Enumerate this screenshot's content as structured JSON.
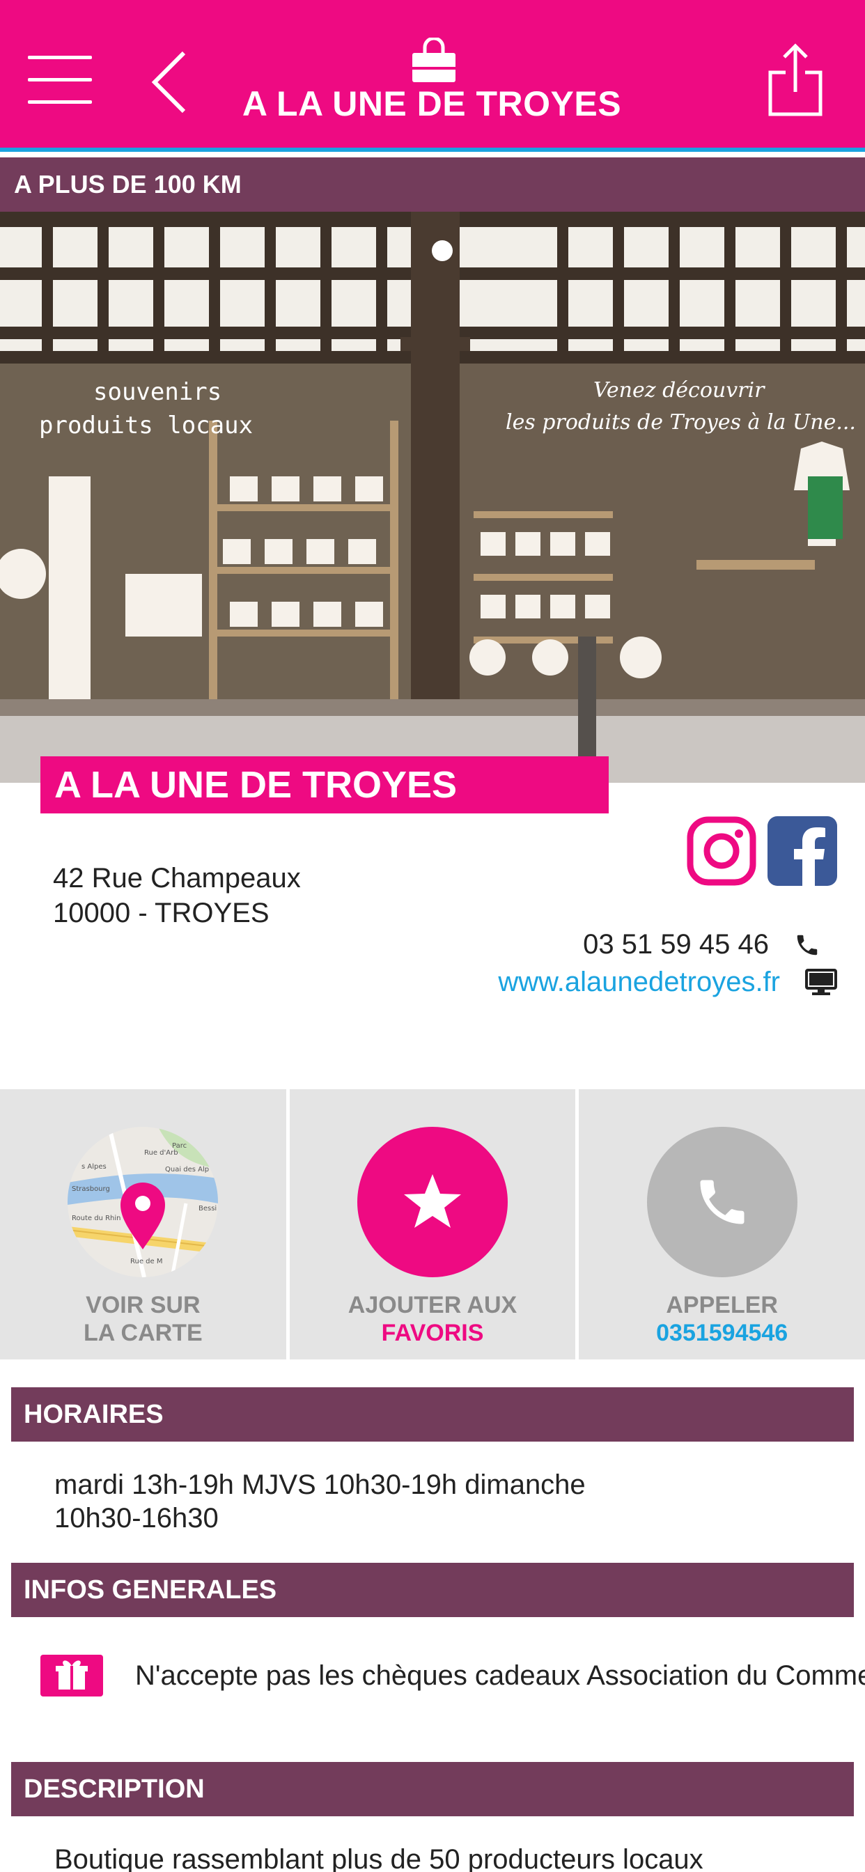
{
  "header": {
    "title": "A LA UNE DE TROYES",
    "menu_icon": "hamburger-menu-icon",
    "back_icon": "chevron-left-icon",
    "bag_icon": "shopping-bag-icon",
    "share_icon": "share-icon"
  },
  "distance": "A PLUS DE 100 KM",
  "photo": {
    "left_window_text_line1": "souvenirs",
    "left_window_text_line2": "produits locaux",
    "right_window_text_line1": "Venez découvrir",
    "right_window_text_line2": "les produits de Troyes à la Une..."
  },
  "shop": {
    "name": "A LA UNE DE TROYES",
    "address_line1": "42 Rue Champeaux",
    "address_line2": "10000 - TROYES",
    "phone": "03 51 59 45 46",
    "website": "www.alaunedetroyes.fr"
  },
  "actions": {
    "map_line1": "VOIR SUR",
    "map_line2": "LA CARTE",
    "fav_line1": "AJOUTER AUX",
    "fav_line2": "FAVORIS",
    "call_line1": "APPELER",
    "call_line2": "0351594546"
  },
  "map_thumbnail": {
    "labels": [
      "Parc",
      "Quai des Alp",
      "s Alpes",
      "Strasbourg",
      "Route du Rhin",
      "Rue de M",
      "Rue d'Arb",
      "Bessi"
    ]
  },
  "sections": {
    "hours_title": "HORAIRES",
    "hours_line1": "mardi 13h-19h  MJVS 10h30-19h  dimanche",
    "hours_line2": "10h30-16h30",
    "info_title": "INFOS GENERALES",
    "info_text": "N'accepte pas les chèques cadeaux Association du Commerce",
    "desc_title": "DESCRIPTION",
    "desc_text": "Boutique rassemblant plus de 50 producteurs locaux"
  },
  "colors": {
    "brand_pink": "#ee0a82",
    "section_purple": "#733c5b",
    "link_blue": "#1aa3e0",
    "action_bg": "#e4e4e4"
  }
}
